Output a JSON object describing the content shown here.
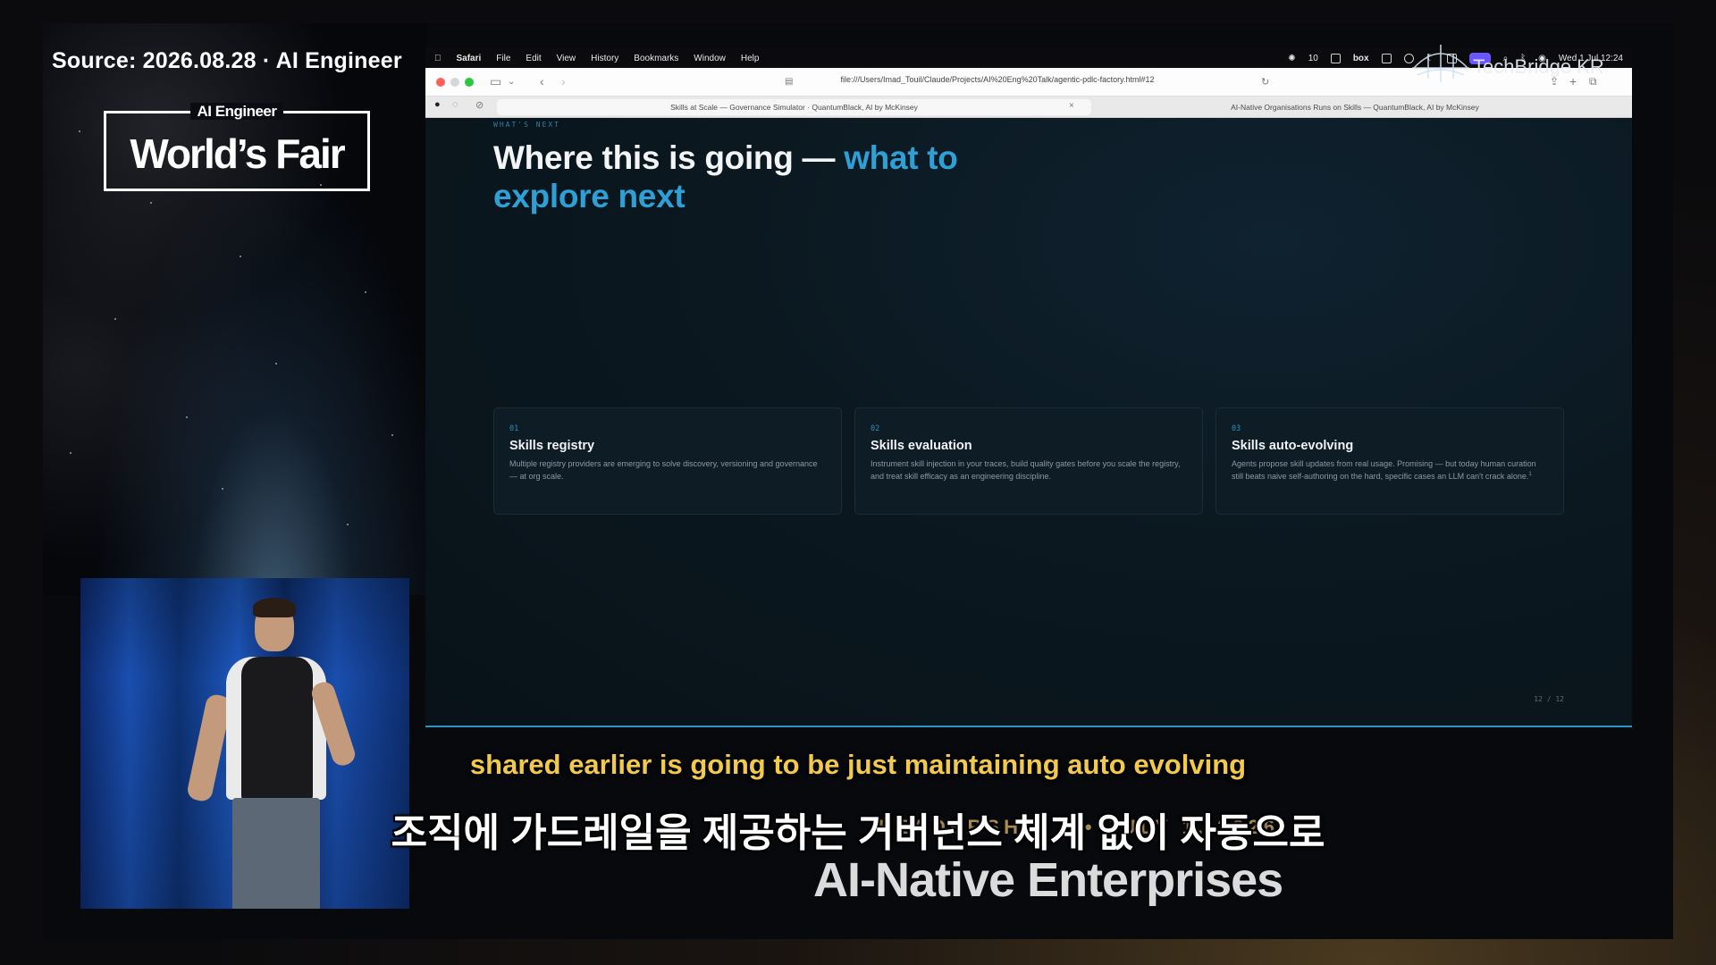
{
  "video": {
    "source_label": "Source: 2026.08.28 · AI Engineer",
    "event_logo": {
      "top": "AI Engineer",
      "main": "World’s Fair"
    },
    "watermark": "TechBridge KR",
    "stage_banner": {
      "line1": "LEADERSHIP 1 • JULY 1, 2026",
      "line2": "AI-Native Enterprises"
    },
    "subtitle_en": "shared earlier is going to be just maintaining auto evolving",
    "subtitle_ko": "조직에 가드레일을 제공하는 거버넌스 체계 없이 자동으로"
  },
  "menubar": {
    "apple": "",
    "app": "Safari",
    "items": [
      "File",
      "Edit",
      "View",
      "History",
      "Bookmarks",
      "Window",
      "Help"
    ],
    "status_count": "10",
    "status_box": "box",
    "clock": "Wed 1 Jul 12:24"
  },
  "browser": {
    "url": "file:///Users/Imad_Touil/Claude/Projects/AI%20Eng%20Talk/agentic-pdlc-factory.html#12",
    "tabs": [
      "Skills at Scale — Governance Simulator · QuantumBlack, AI by McKinsey",
      "AI-Native Organisations Runs on Skills — QuantumBlack, AI by McKinsey"
    ],
    "tab_close": "×"
  },
  "slide": {
    "kicker": "WHAT'S NEXT",
    "headline_prefix": "Where this is going —",
    "headline_accent_1": "what",
    "headline_accent_2": "to explore next",
    "cards": [
      {
        "num": "01",
        "title": "Skills registry",
        "body": "Multiple registry providers are emerging to solve discovery, versioning and governance — at org scale."
      },
      {
        "num": "02",
        "title": "Skills evaluation",
        "body": "Instrument skill injection in your traces, build quality gates before you scale the registry, and treat skill efficacy as an engineering discipline."
      },
      {
        "num": "03",
        "title": "Skills auto-evolving",
        "body": "Agents propose skill updates from real usage. Promising — but today human curation still beats naive self-authoring on the hard, specific cases an LLM can't crack alone.",
        "footnote": "1"
      }
    ],
    "page_indicator": "12 / 12"
  },
  "colors": {
    "accent": "#2ea0d6",
    "subtitle_en": "#f2c94c",
    "slide_bg": "#0b1820"
  }
}
